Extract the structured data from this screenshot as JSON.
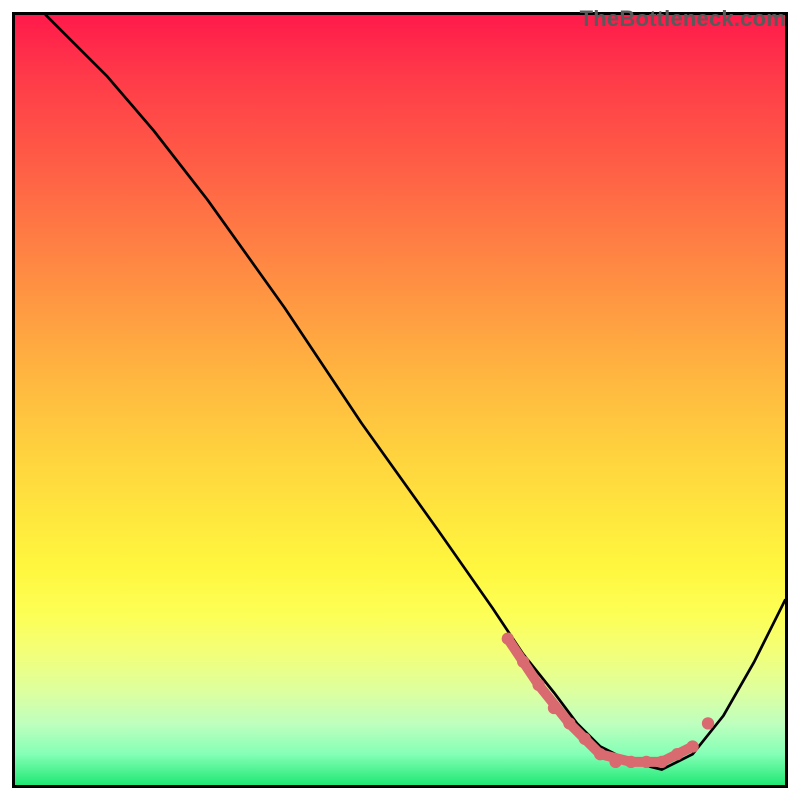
{
  "watermark": "TheBottleneck.com",
  "chart_data": {
    "type": "line",
    "title": "",
    "xlabel": "",
    "ylabel": "",
    "xlim": [
      0,
      100
    ],
    "ylim": [
      0,
      100
    ],
    "gradient_stops": [
      {
        "pos_pct": 0,
        "color": "#ff1a4b"
      },
      {
        "pos_pct": 8,
        "color": "#ff3a49"
      },
      {
        "pos_pct": 18,
        "color": "#ff5946"
      },
      {
        "pos_pct": 28,
        "color": "#ff7a44"
      },
      {
        "pos_pct": 38,
        "color": "#ff9a42"
      },
      {
        "pos_pct": 48,
        "color": "#ffb940"
      },
      {
        "pos_pct": 58,
        "color": "#ffd53e"
      },
      {
        "pos_pct": 66,
        "color": "#ffe93d"
      },
      {
        "pos_pct": 72,
        "color": "#fff73f"
      },
      {
        "pos_pct": 78,
        "color": "#fdff56"
      },
      {
        "pos_pct": 83,
        "color": "#f2ff7a"
      },
      {
        "pos_pct": 88,
        "color": "#dcffa0"
      },
      {
        "pos_pct": 92,
        "color": "#bfffbe"
      },
      {
        "pos_pct": 96,
        "color": "#84ffb6"
      },
      {
        "pos_pct": 100,
        "color": "#20e874"
      }
    ],
    "series": [
      {
        "name": "bottleneck-curve",
        "stroke": "#000000",
        "x": [
          4,
          8,
          12,
          18,
          25,
          35,
          45,
          55,
          62,
          66,
          70,
          73,
          76,
          80,
          84,
          88,
          92,
          96,
          100
        ],
        "y": [
          100,
          96,
          92,
          85,
          76,
          62,
          47,
          33,
          23,
          17,
          12,
          8,
          5,
          3,
          2,
          4,
          9,
          16,
          24
        ]
      }
    ],
    "highlight_band": {
      "name": "valley-highlight",
      "stroke": "#d96a6f",
      "x": [
        64,
        68,
        72,
        76,
        80,
        84,
        88
      ],
      "y": [
        19,
        13,
        8,
        4,
        3,
        3,
        5
      ]
    },
    "highlight_dots": {
      "name": "valley-dots",
      "fill": "#d96a6f",
      "x": [
        64,
        66,
        68,
        70,
        72,
        74,
        76,
        78,
        80,
        82,
        84,
        86,
        88,
        90
      ],
      "y": [
        19,
        16,
        13,
        10,
        8,
        6,
        4,
        3,
        3,
        3,
        3,
        4,
        5,
        8
      ]
    }
  }
}
